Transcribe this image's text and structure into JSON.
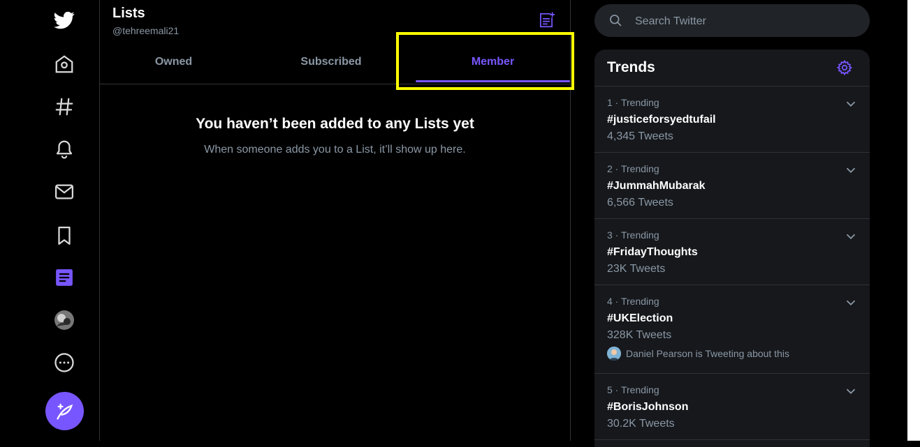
{
  "colors": {
    "accent": "#7856ff",
    "background": "#000000",
    "panel": "#16181c",
    "muted": "#8b98a5",
    "highlight": "#ffff00"
  },
  "nav": [
    {
      "name": "twitter-logo-icon"
    },
    {
      "name": "home-icon"
    },
    {
      "name": "explore-hashtag-icon"
    },
    {
      "name": "notifications-bell-icon"
    },
    {
      "name": "messages-envelope-icon"
    },
    {
      "name": "bookmarks-icon"
    },
    {
      "name": "lists-icon"
    },
    {
      "name": "profile-avatar"
    },
    {
      "name": "more-icon"
    }
  ],
  "header": {
    "title": "Lists",
    "handle": "@tehreemali21"
  },
  "tabs": [
    {
      "label": "Owned",
      "active": false
    },
    {
      "label": "Subscribed",
      "active": false
    },
    {
      "label": "Member",
      "active": true
    }
  ],
  "empty_state": {
    "title": "You haven’t been added to any Lists yet",
    "subtitle": "When someone adds you to a List, it’ll show up here."
  },
  "search": {
    "placeholder": "Search Twitter"
  },
  "trends": {
    "title": "Trends",
    "items": [
      {
        "meta": "1 · Trending",
        "name": "#justiceforsyedtufail",
        "count": "4,345 Tweets"
      },
      {
        "meta": "2 · Trending",
        "name": "#JummahMubarak",
        "count": "6,566 Tweets"
      },
      {
        "meta": "3 · Trending",
        "name": "#FridayThoughts",
        "count": "23K Tweets"
      },
      {
        "meta": "4 · Trending",
        "name": "#UKElection",
        "count": "328K Tweets",
        "context": "Daniel Pearson is Tweeting about this"
      },
      {
        "meta": "5 · Trending",
        "name": "#BorisJohnson",
        "count": "30.2K Tweets"
      }
    ]
  }
}
